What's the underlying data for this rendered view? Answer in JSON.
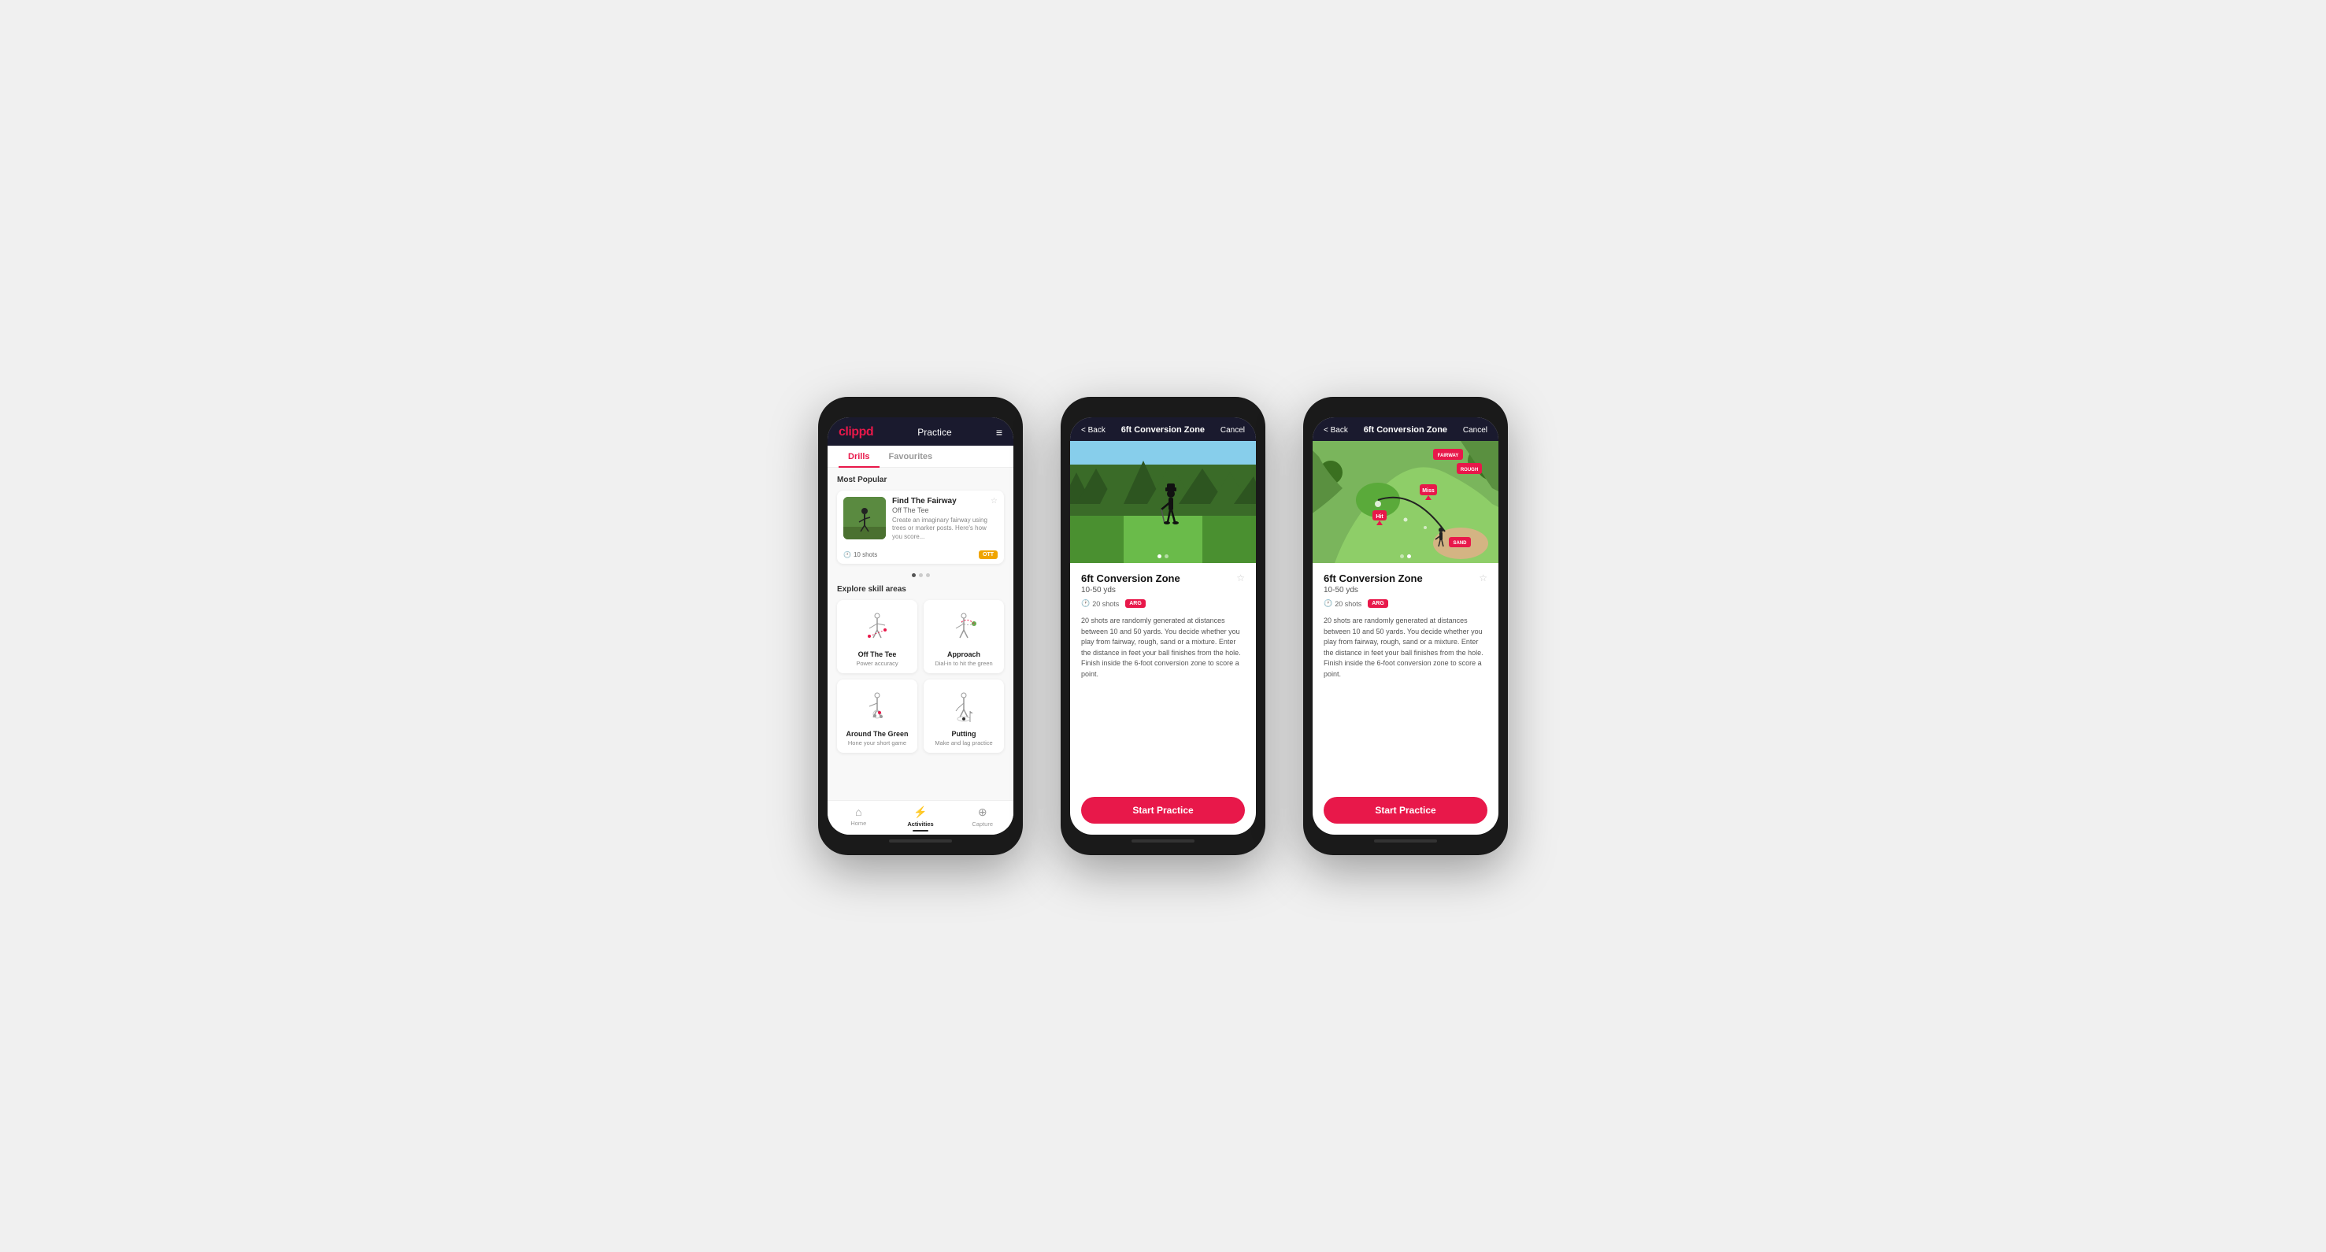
{
  "phones": {
    "phone1": {
      "header": {
        "logo": "clippd",
        "title": "Practice",
        "menu_icon": "≡"
      },
      "tabs": [
        {
          "label": "Drills",
          "active": true
        },
        {
          "label": "Favourites",
          "active": false
        }
      ],
      "most_popular_label": "Most Popular",
      "featured_drill": {
        "title": "Find The Fairway",
        "subtitle": "Off The Tee",
        "description": "Create an imaginary fairway using trees or marker posts. Here's how you score...",
        "shots": "10 shots",
        "badge": "OTT"
      },
      "dots": [
        "active",
        "inactive",
        "inactive"
      ],
      "explore_label": "Explore skill areas",
      "skills": [
        {
          "name": "Off The Tee",
          "desc": "Power accuracy",
          "icon": "ott"
        },
        {
          "name": "Approach",
          "desc": "Dial-in to hit the green",
          "icon": "approach"
        },
        {
          "name": "Around The Green",
          "desc": "Hone your short game",
          "icon": "atg"
        },
        {
          "name": "Putting",
          "desc": "Make and lag practice",
          "icon": "putting"
        }
      ],
      "nav": [
        {
          "label": "Home",
          "icon": "⌂",
          "active": false
        },
        {
          "label": "Activities",
          "icon": "⚡",
          "active": true
        },
        {
          "label": "Capture",
          "icon": "⊕",
          "active": false
        }
      ]
    },
    "phone2": {
      "header": {
        "back": "< Back",
        "title": "6ft Conversion Zone",
        "cancel": "Cancel"
      },
      "drill": {
        "name": "6ft Conversion Zone",
        "range": "10-50 yds",
        "shots": "20 shots",
        "badge": "ARG",
        "description": "20 shots are randomly generated at distances between 10 and 50 yards. You decide whether you play from fairway, rough, sand or a mixture. Enter the distance in feet your ball finishes from the hole. Finish inside the 6-foot conversion zone to score a point.",
        "start_btn": "Start Practice"
      },
      "image_type": "photo",
      "dots": [
        "active",
        "inactive"
      ]
    },
    "phone3": {
      "header": {
        "back": "< Back",
        "title": "6ft Conversion Zone",
        "cancel": "Cancel"
      },
      "drill": {
        "name": "6ft Conversion Zone",
        "range": "10-50 yds",
        "shots": "20 shots",
        "badge": "ARG",
        "description": "20 shots are randomly generated at distances between 10 and 50 yards. You decide whether you play from fairway, rough, sand or a mixture. Enter the distance in feet your ball finishes from the hole. Finish inside the 6-foot conversion zone to score a point.",
        "start_btn": "Start Practice"
      },
      "image_type": "diagram",
      "dots": [
        "inactive",
        "active"
      ]
    }
  }
}
